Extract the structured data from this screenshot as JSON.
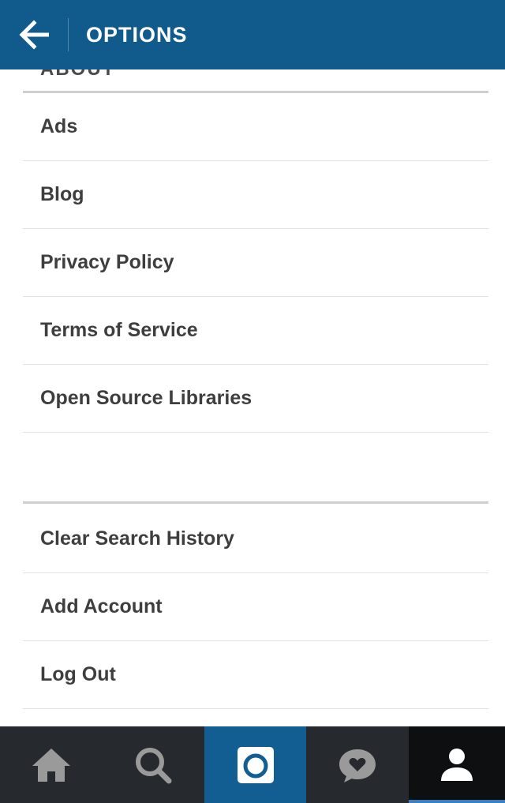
{
  "header": {
    "title": "OPTIONS"
  },
  "about_section": {
    "title_cut": "ABOUT"
  },
  "about_items": [
    {
      "label": "Ads"
    },
    {
      "label": "Blog"
    },
    {
      "label": "Privacy Policy"
    },
    {
      "label": "Terms of Service"
    },
    {
      "label": "Open Source Libraries"
    }
  ],
  "account_items": [
    {
      "label": "Clear Search History"
    },
    {
      "label": "Add Account"
    },
    {
      "label": "Log Out"
    }
  ],
  "tabbar": {
    "tabs": [
      {
        "icon": "home-icon"
      },
      {
        "icon": "search-icon"
      },
      {
        "icon": "camera-icon"
      },
      {
        "icon": "activity-icon"
      },
      {
        "icon": "profile-icon",
        "active": true
      }
    ]
  },
  "colors": {
    "header_bg": "#115a8c",
    "tabbar_bg": "#262a2e",
    "camera_tab_bg": "#125e93",
    "profile_tab_bg": "#0e0f10",
    "row_text": "#3e3e3e"
  }
}
